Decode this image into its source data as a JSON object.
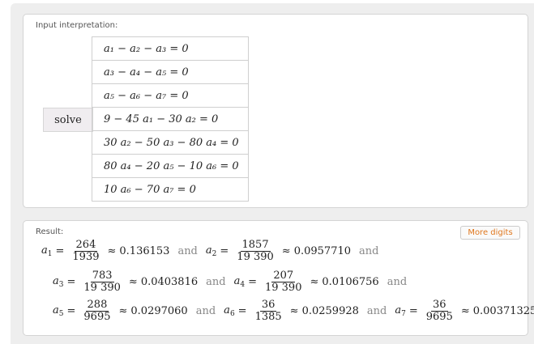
{
  "input_pod": {
    "title": "Input interpretation:",
    "solve_label": "solve",
    "equations": [
      "a₁ − a₂ − a₃ = 0",
      "a₃ − a₄ − a₅ = 0",
      "a₅ − a₆ − a₇ = 0",
      "9 − 45 a₁ − 30 a₂ = 0",
      "30 a₂ − 50 a₃ − 80 a₄ = 0",
      "80 a₄ − 20 a₅ − 10 a₆ = 0",
      "10 a₆ − 70 a₇ = 0"
    ]
  },
  "result_pod": {
    "title": "Result:",
    "more_digits_label": "More digits",
    "and_label": "and",
    "results": [
      {
        "var": "a",
        "sub": "1",
        "num": "264",
        "den": "1939",
        "approx": "0.136153"
      },
      {
        "var": "a",
        "sub": "2",
        "num": "1857",
        "den": "19 390",
        "approx": "0.0957710"
      },
      {
        "var": "a",
        "sub": "3",
        "num": "783",
        "den": "19 390",
        "approx": "0.0403816"
      },
      {
        "var": "a",
        "sub": "4",
        "num": "207",
        "den": "19 390",
        "approx": "0.0106756"
      },
      {
        "var": "a",
        "sub": "5",
        "num": "288",
        "den": "9695",
        "approx": "0.0297060"
      },
      {
        "var": "a",
        "sub": "6",
        "num": "36",
        "den": "1385",
        "approx": "0.0259928"
      },
      {
        "var": "a",
        "sub": "7",
        "num": "36",
        "den": "9695",
        "approx": "0.00371325"
      }
    ]
  }
}
